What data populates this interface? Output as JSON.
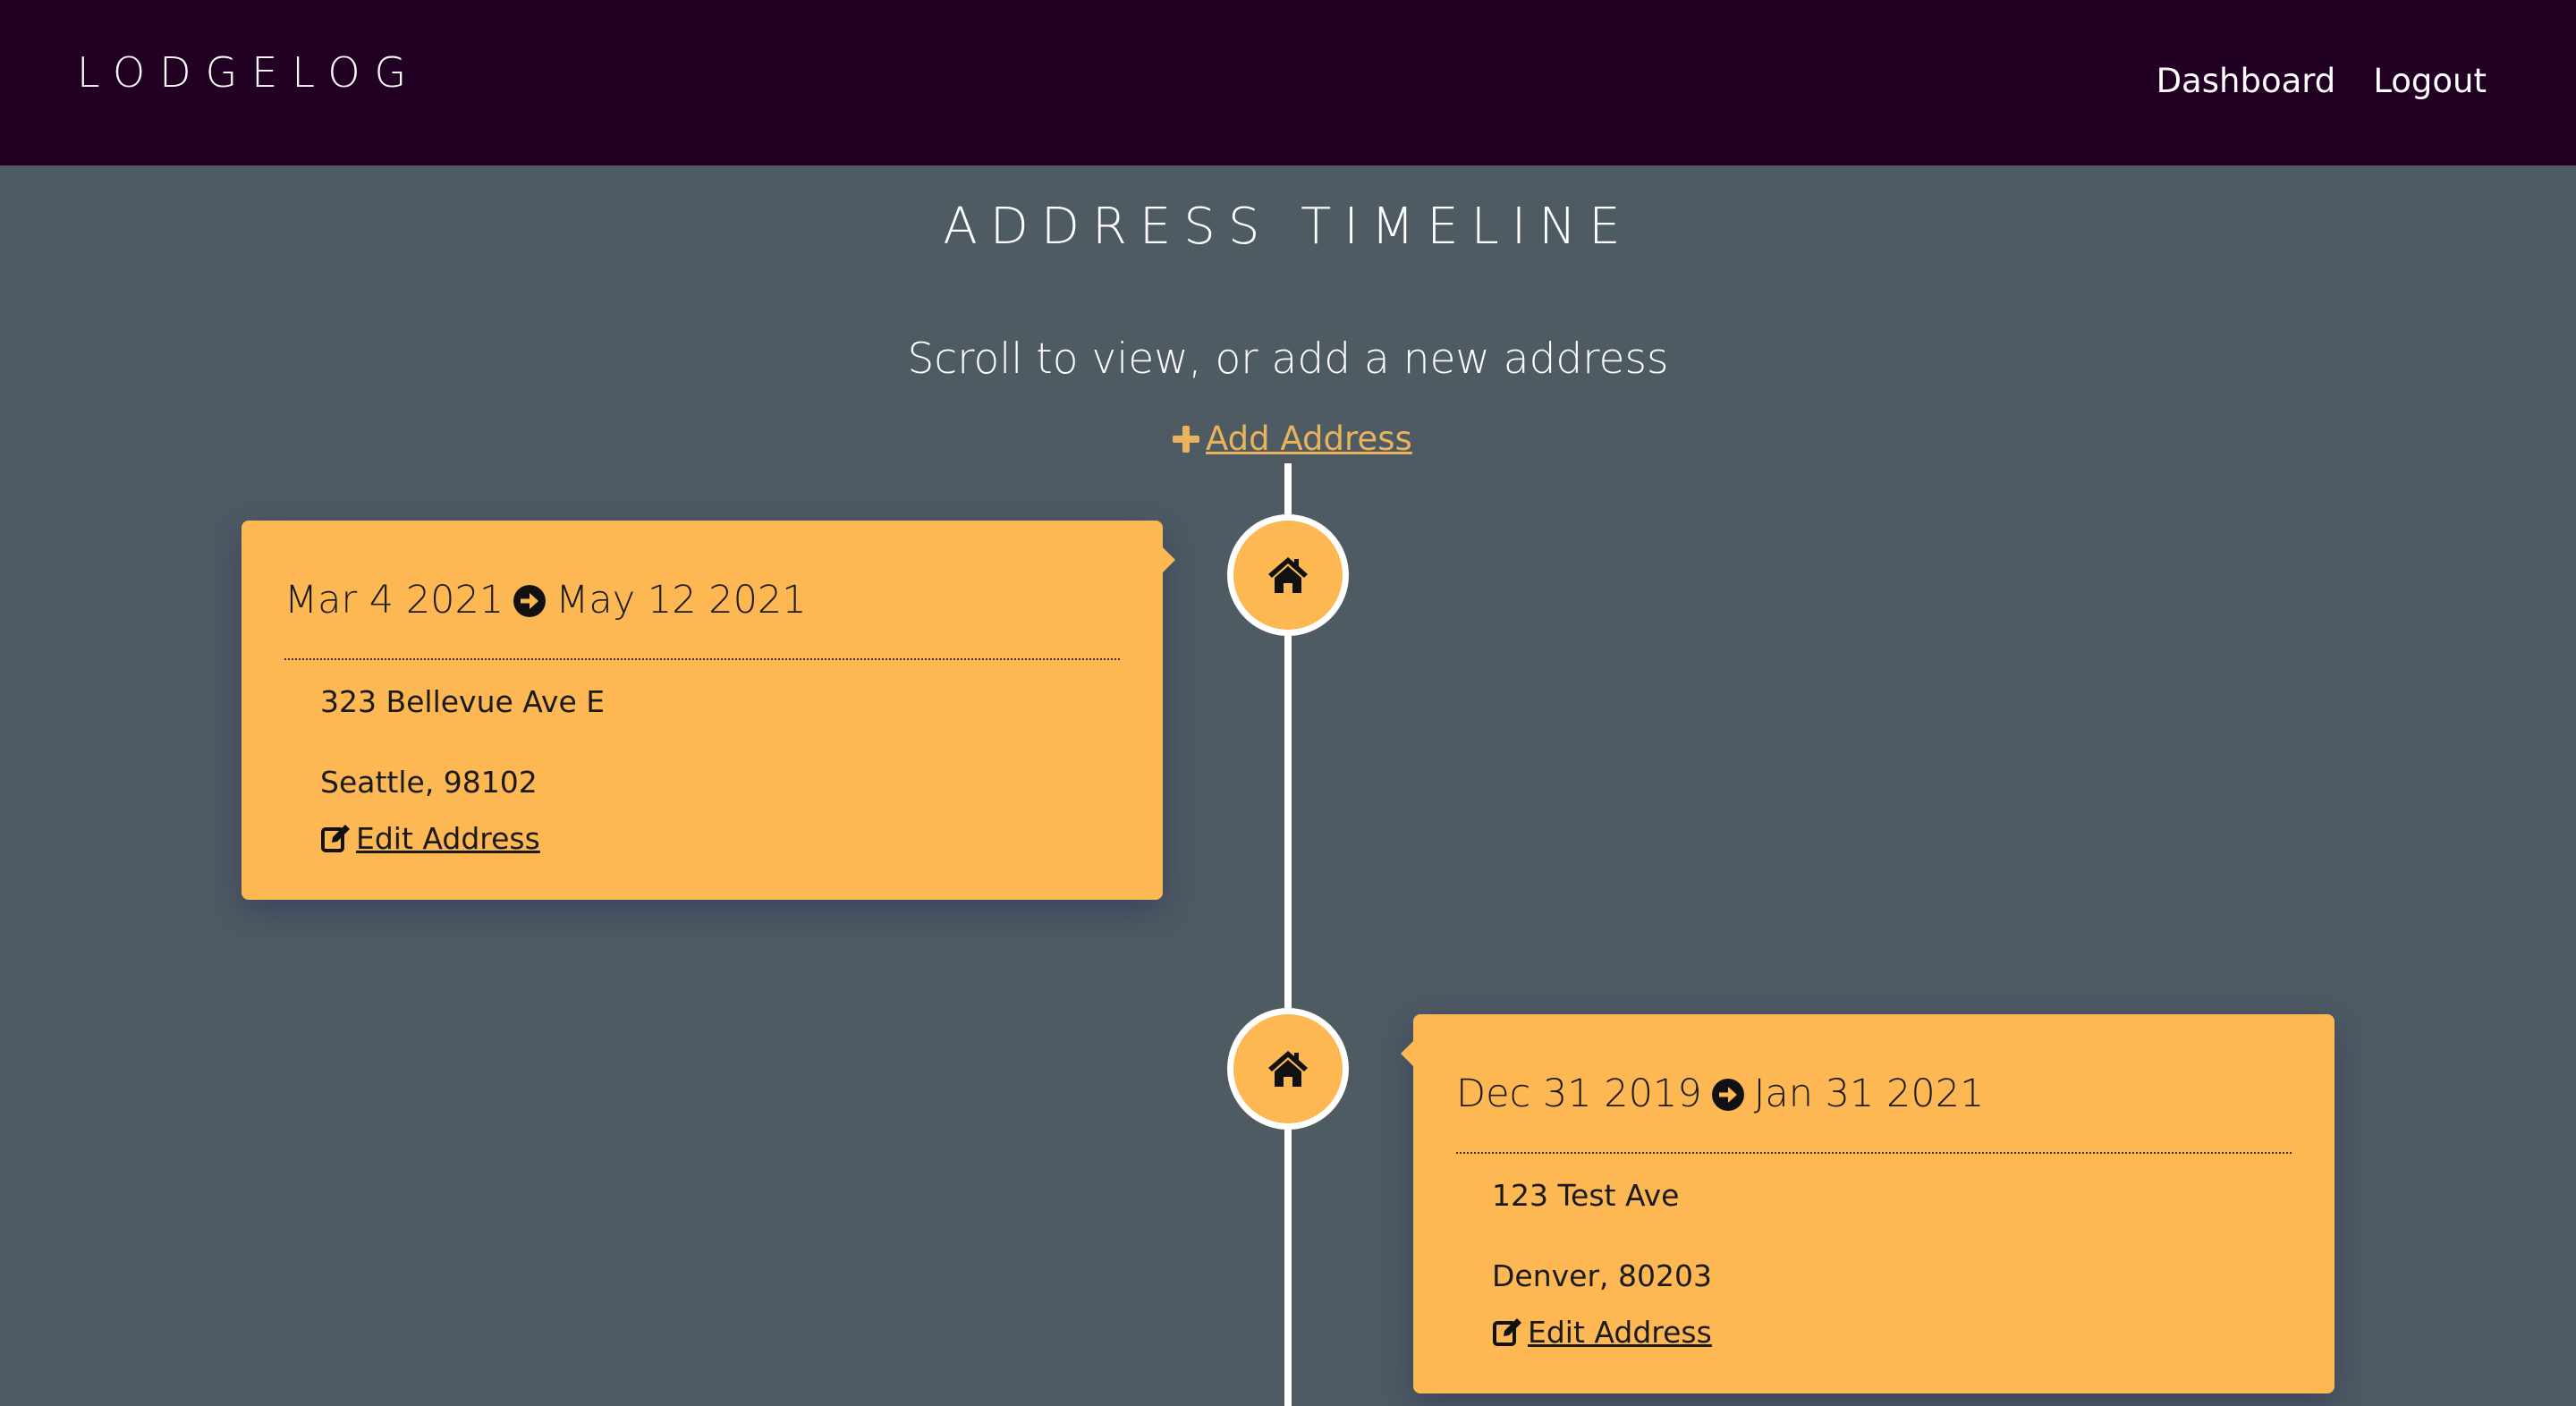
{
  "navbar": {
    "brand": "LODGELOG",
    "links": [
      "Dashboard",
      "Logout"
    ]
  },
  "page": {
    "title": "ADDRESS TIMELINE",
    "subtitle": "Scroll to view, or add a new address",
    "add_label": "Add Address"
  },
  "entries": [
    {
      "start": "Mar 4 2021",
      "end": "May 12 2021",
      "street": "323 Bellevue Ave E",
      "city": "Seattle, 98102",
      "edit_label": "Edit Address"
    },
    {
      "start": "Dec 31 2019",
      "end": "Jan 31 2021",
      "street": "123 Test Ave",
      "city": "Denver, 80203",
      "edit_label": "Edit Address"
    }
  ],
  "icons": {
    "add": "plus-icon",
    "marker": "home-icon",
    "date_separator": "arrow-right-circle-icon",
    "edit": "edit-icon"
  },
  "colors": {
    "navbar": "#220023",
    "background": "#4e5b63",
    "card": "#fdb853",
    "accent_link": "#e9b35d",
    "timeline": "#ffffff"
  }
}
